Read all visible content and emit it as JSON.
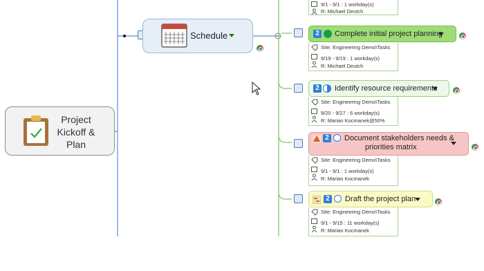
{
  "central": {
    "label": "Project Kickoff & Plan",
    "icon": "clipboard-check-icon"
  },
  "schedule": {
    "label": "Schedule",
    "icon": "calendar-icon"
  },
  "top_partial": {
    "date": "9/1 - 9/1 : 1 workday(s)",
    "resource": "R: Michael Deutch"
  },
  "tasks": [
    {
      "priority": "2",
      "status": "complete",
      "label": "Complete initial project planning",
      "site": "Site: Engineering Demo\\Tasks",
      "date": "9/19 - 9/19 : 1 workday(s)",
      "resource": "R: Michael Deutch"
    },
    {
      "priority": "2",
      "status": "half",
      "label": "Identify resource requirements",
      "site": "Site: Engineering Demo\\Tasks",
      "date": "9/20 - 9/27 : 6 workday(s)",
      "resource": "R: Marian Kocmanek@50%"
    },
    {
      "priority": "2",
      "status": "open",
      "label_line1": "Document stakeholders needs &",
      "label_line2": "priorities matrix",
      "site": "Site: Engineering Demo\\Tasks",
      "date": "9/1 - 9/1 : 1 workday(s)",
      "resource": "R: Marian Kocmanek"
    },
    {
      "priority": "2",
      "status": "open",
      "label": "Draft the project plan",
      "site": "Site: Engineering Demo\\Tasks",
      "date": "9/1 - 9/15 : 11 workday(s)",
      "resource": "R: Marian Kocmanek"
    }
  ],
  "colors": {
    "complete_fill": "#9fdc78",
    "alert_fill": "#f6c6c6",
    "draft_fill": "#fafac4",
    "branch": "#5b8fd0",
    "task_branch": "#7cc46b"
  }
}
